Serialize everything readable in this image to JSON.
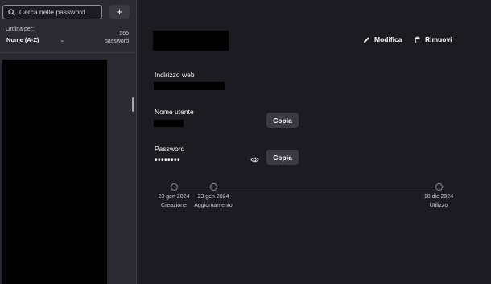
{
  "sidebar": {
    "search_placeholder": "Cerca nelle password",
    "add_label": "+",
    "sort_label": "Ordina per:",
    "sort_value": "Nome (A-Z)",
    "count_number": "565",
    "count_unit": "password",
    "scroll_position": 0.19
  },
  "detail": {
    "edit_label": "Modifica",
    "remove_label": "Rimuovi",
    "fields": {
      "website_label": "Indirizzo web",
      "username_label": "Nome utente",
      "password_label": "Password",
      "password_mask": "••••••••",
      "copy_label": "Copia"
    },
    "timeline": [
      {
        "date": "23 gen 2024",
        "name": "Creazione"
      },
      {
        "date": "23 gen 2024",
        "name": "Aggiornamento"
      },
      {
        "date": "18 dic 2024",
        "name": "Utilizzo"
      }
    ]
  },
  "colors": {
    "background": "#1c1b22",
    "sidebar": "#2b2a33",
    "button": "#3a3944",
    "text": "#fbfbfe"
  }
}
